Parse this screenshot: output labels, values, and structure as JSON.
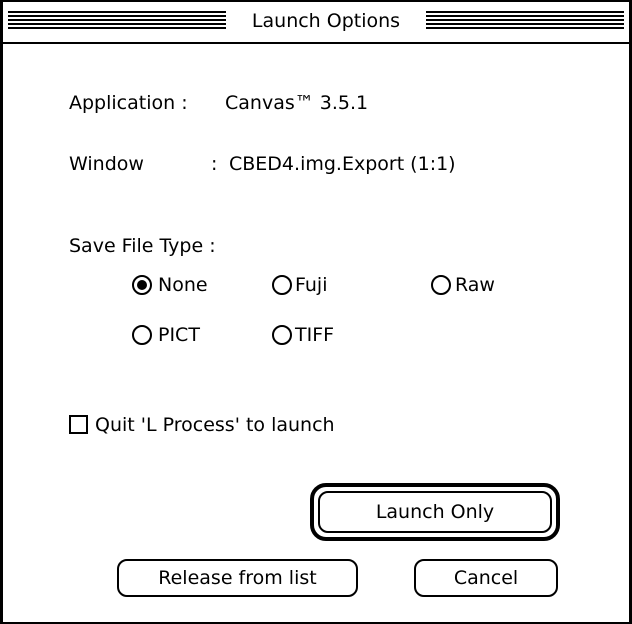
{
  "window": {
    "title": "Launch Options"
  },
  "info": {
    "application_label": "Application :",
    "application_value": "Canvas™ 3.5.1",
    "window_label": "Window",
    "window_colon": ":",
    "window_value": "CBED4.img.Export (1:1)"
  },
  "save_file_type": {
    "label": "Save File Type :",
    "options": [
      {
        "label": "None",
        "selected": true
      },
      {
        "label": "Fuji",
        "selected": false
      },
      {
        "label": "Raw",
        "selected": false
      },
      {
        "label": "PICT",
        "selected": false
      },
      {
        "label": "TIFF",
        "selected": false
      }
    ]
  },
  "quit_checkbox": {
    "label": "Quit 'L Process' to launch",
    "checked": false
  },
  "buttons": {
    "launch_only": "Launch Only",
    "release": "Release from list",
    "cancel": "Cancel"
  }
}
